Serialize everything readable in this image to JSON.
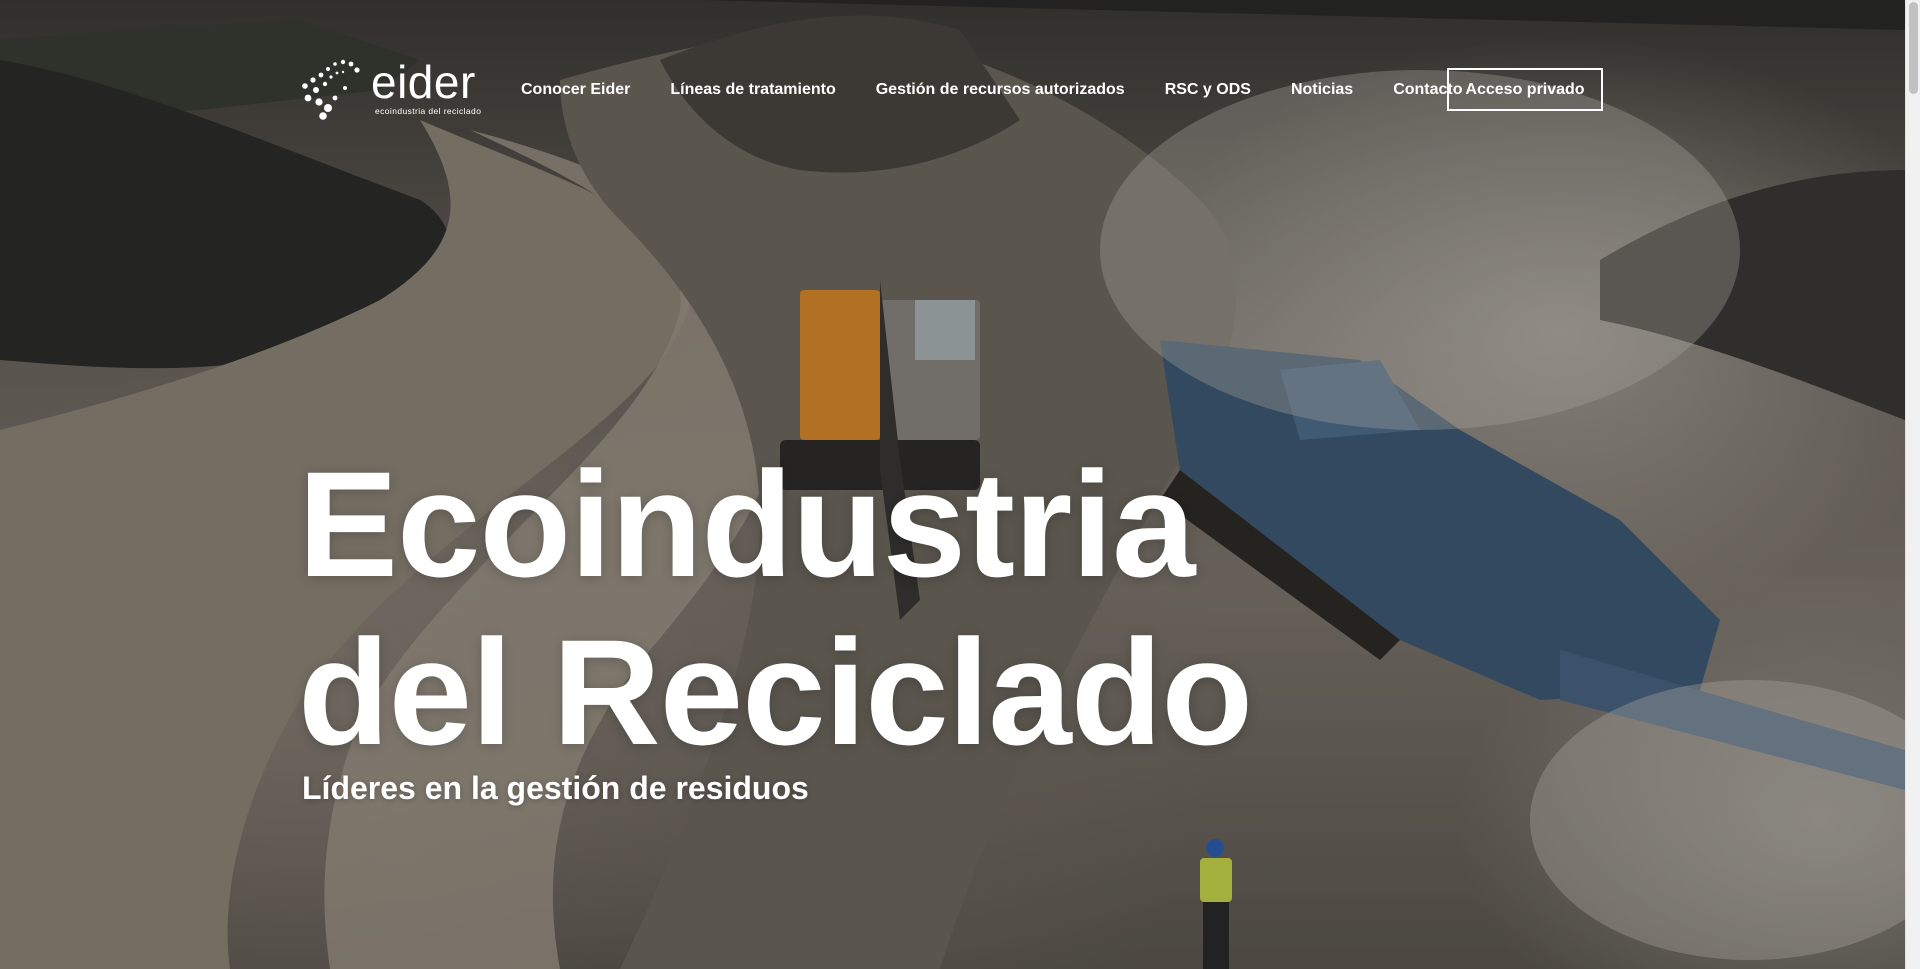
{
  "brand": {
    "name": "eider",
    "tagline": "ecoindustria del reciclado"
  },
  "nav": {
    "items": [
      {
        "label": "Conocer Eider"
      },
      {
        "label": "Líneas de tratamiento"
      },
      {
        "label": "Gestión de recursos autorizados"
      },
      {
        "label": "RSC y ODS"
      },
      {
        "label": "Noticias"
      },
      {
        "label": "Contacto"
      }
    ],
    "cta_label": "Acceso privado"
  },
  "hero": {
    "title_line1": "Ecoindustria",
    "title_line2": "del Reciclado",
    "subtitle": "Líderes en la gestión de residuos",
    "background_icon": "recycling-site-photo"
  },
  "colors": {
    "text": "#ffffff",
    "overlay": "#000000"
  }
}
